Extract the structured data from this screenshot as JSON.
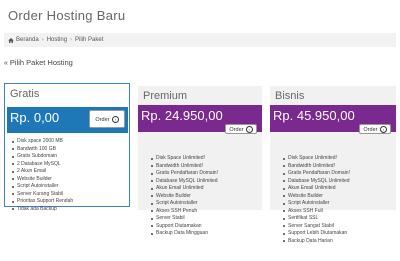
{
  "page": {
    "title": "Order Hosting Baru"
  },
  "breadcrumb": {
    "items": [
      "Beranda",
      "Hosting",
      "Pilih Paket"
    ]
  },
  "section": {
    "title": "Pilih Paket Hosting"
  },
  "order_label": "Order",
  "colors": {
    "price_band_selected": "#1e78b8",
    "price_band": "#7a2a8e",
    "selected_border": "#3d7fd6"
  },
  "plans": [
    {
      "name": "Gratis",
      "price": "Rp. 0,00",
      "features": [
        "Disk space 2000 MB",
        "Bandwith 100 GB",
        "Gratis Subdomain",
        "2 Database MySQL",
        "2 Akun Email",
        "Website Builder",
        "Script Autoinstaller",
        "Server Kurang Stabil",
        "Prioritas Support Rendah",
        "Tidak ada Backup"
      ]
    },
    {
      "name": "Premium",
      "price": "Rp. 24.950,00",
      "features": [
        "Disk Space Unlimited!",
        "Bandwidth Unlimited!",
        "Gratis Pendaftaran Domain!",
        "Database MySQL Unlimited",
        "Akun Email Unlimited",
        "Website Builder",
        "Script Autoinstaller",
        "Akses SSH Penuh",
        "Server Stabil",
        "Support Diutamakan",
        "Backup Data Mingguan"
      ]
    },
    {
      "name": "Bisnis",
      "price": "Rp. 45.950,00",
      "features": [
        "Disk Space Unlimited!",
        "Bandwidth Unlimited!",
        "Gratis Pendaftaran Domain!",
        "Database MySQL Unlimited",
        "Akun Email Unlimited",
        "Website Builder",
        "Script Autoinstaller",
        "Akses SSH Full",
        "Sertifikat SSL",
        "Server Sangat Stabil",
        "Support Lebih Diutamakan",
        "Backup Data Harian"
      ]
    }
  ]
}
